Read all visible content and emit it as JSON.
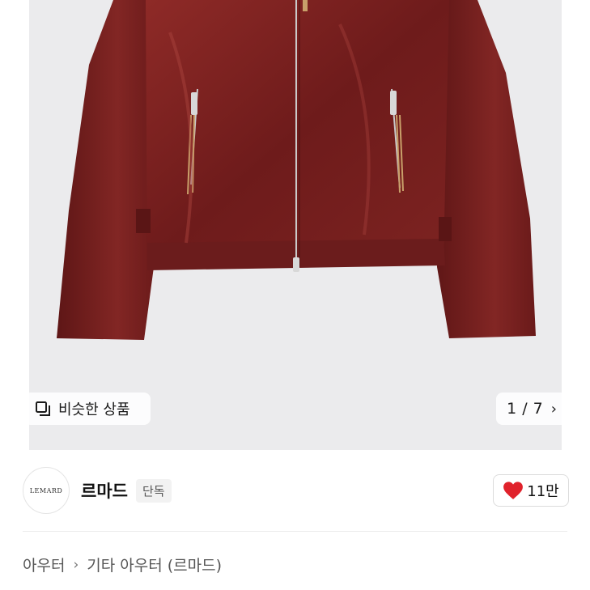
{
  "product": {
    "similar_label": "비슷한 상품",
    "pager": {
      "current": "1",
      "separator": "/",
      "total": "7"
    }
  },
  "shop": {
    "logo_text": "LEMARD",
    "name": "르마드",
    "badge": "단독",
    "likes": "11만"
  },
  "breadcrumb": {
    "level1": "아우터",
    "level2": "기타 아우터 (르마드)"
  },
  "colors": {
    "jacket": "#7a1f1f",
    "heart": "#e0222b",
    "image_bg": "#ebebed"
  }
}
